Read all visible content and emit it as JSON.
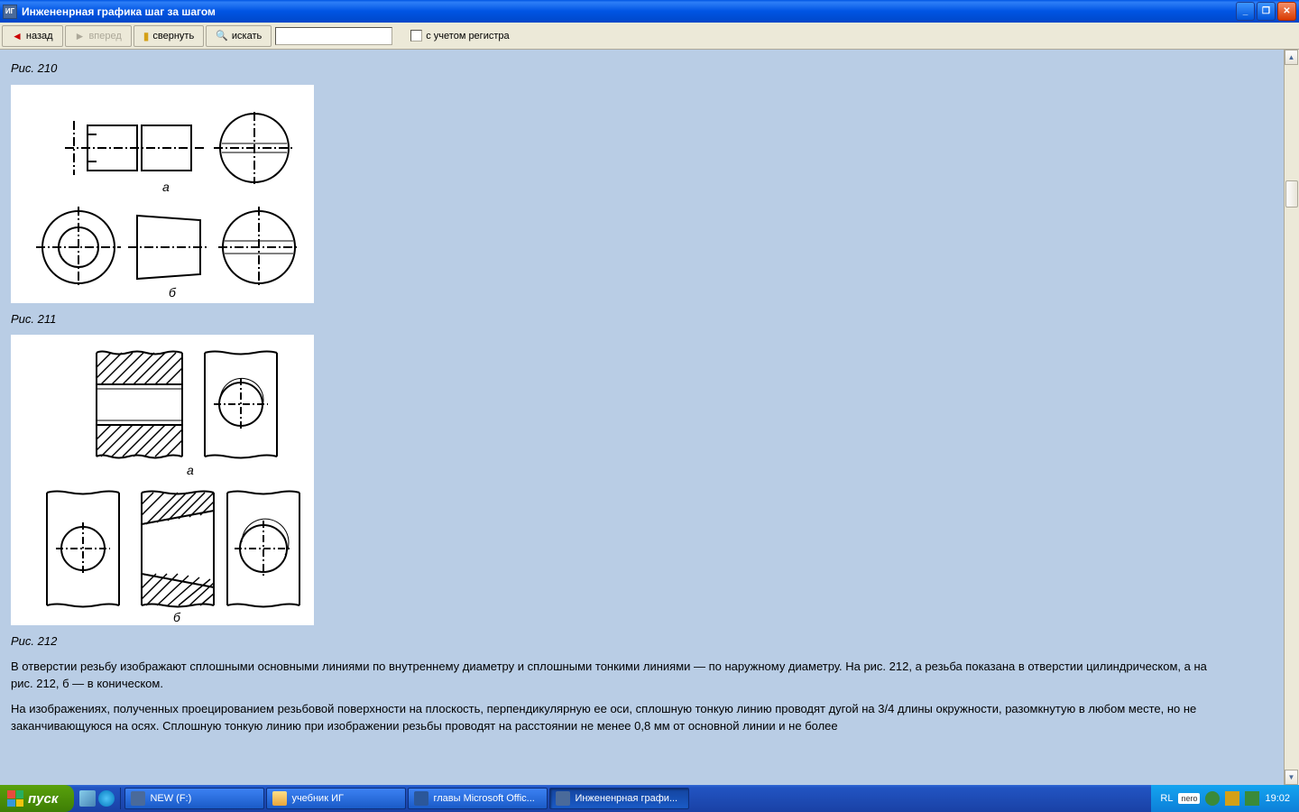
{
  "window": {
    "icon_text": "ИГ",
    "title": "Инжененрная графика шаг за шагом"
  },
  "toolbar": {
    "back": "назад",
    "forward": "вперед",
    "collapse": "свернуть",
    "search": "искать",
    "search_value": "",
    "case_sensitive": "с учетом регистра"
  },
  "content": {
    "fig210_caption": "Рис. 210",
    "fig210_label_a": "a",
    "fig210_label_b": "б",
    "fig211_caption": "Рис. 211",
    "fig211_label_a": "a",
    "fig211_label_b": "б",
    "fig212_caption": "Рис. 212",
    "para1": "В отверстии резьбу изображают сплошными основными линиями по внутреннему диаметру и сплошными тонкими линиями — по наружному диаметру. На рис. 212, а резьба показана в отверстии цилиндрическом, а на рис. 212, б — в коническом.",
    "para2": "На изображениях, полученных проецированием резьбовой поверхности на плоскость, перпендикулярную ее оси, сплошную тонкую линию проводят дугой на 3/4 длины окружности, разомкнутую в любом месте, но не заканчивающуюся на осях. Сплошную тонкую линию при изображении резьбы проводят на расстоянии не менее 0,8 мм от основной линии и не более"
  },
  "taskbar": {
    "start": "пуск",
    "items": [
      {
        "label": "NEW (F:)",
        "icon": "window-icon"
      },
      {
        "label": "учебник ИГ",
        "icon": "folder-icon"
      },
      {
        "label": "главы Microsoft Offic...",
        "icon": "word-icon"
      },
      {
        "label": "Инжененрная графи...",
        "icon": "app-icon"
      }
    ],
    "lang": "RL",
    "nero": "nero",
    "clock": "19:02"
  }
}
